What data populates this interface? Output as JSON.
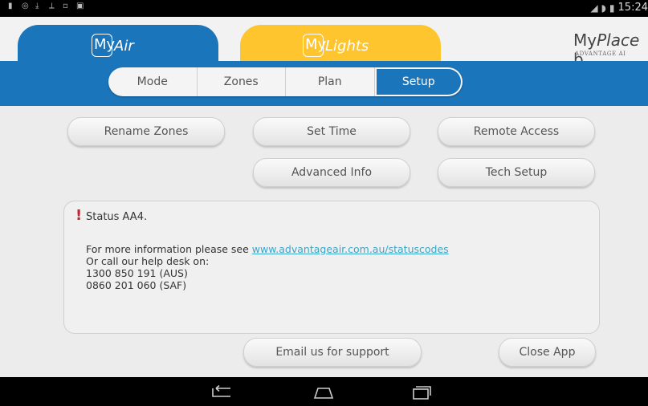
{
  "statusbar": {
    "time": "15:24",
    "icons": [
      "notification-icon",
      "circle-icon",
      "download-icon",
      "usb-icon",
      "image-icon",
      "gallery-icon",
      "signal-icon",
      "wifi-icon",
      "battery-icon"
    ]
  },
  "header": {
    "tab_myair": {
      "my": "My",
      "word": "Air"
    },
    "tab_mylights": {
      "my": "My",
      "word": "Lights"
    },
    "brand": {
      "my": "My",
      "place": "Place",
      "suffix": " b",
      "sub": "ADVANTAGE AI"
    }
  },
  "nav": {
    "segments": [
      "Mode",
      "Zones",
      "Plan",
      "Setup"
    ],
    "active": "Setup"
  },
  "setup_buttons": {
    "rename_zones": "Rename Zones",
    "set_time": "Set Time",
    "remote_access": "Remote Access",
    "advanced_info": "Advanced Info",
    "tech_setup": "Tech Setup"
  },
  "message": {
    "title": "Status AA4.",
    "info_prefix": "For more information please see ",
    "link": "www.advantageair.com.au/statuscodes",
    "help_line": "Or call our help desk on:",
    "phone_aus": "1300 850 191 (AUS)",
    "phone_saf": "0860 201 060 (SAF)"
  },
  "actions": {
    "email_support": "Email us for support",
    "close_app": "Close App"
  },
  "colors": {
    "brand_blue": "#1b75bb",
    "brand_yellow": "#fec52e",
    "alert_red": "#d0202a",
    "link": "#3aa6c8"
  }
}
